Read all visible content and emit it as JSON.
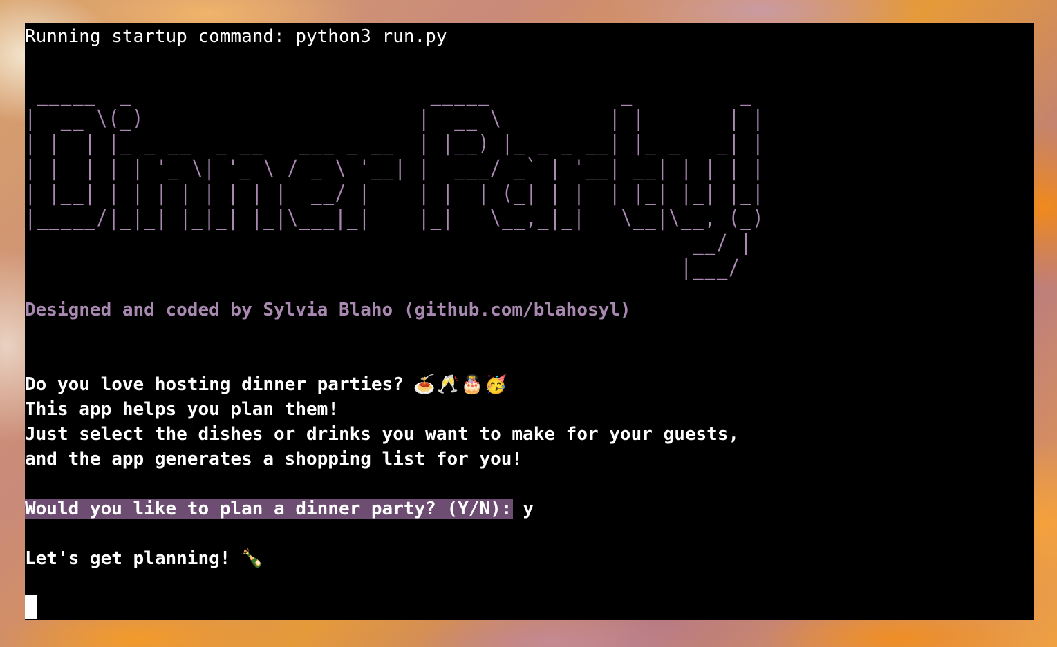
{
  "terminal": {
    "startup_command": "Running startup command: python3 run.py",
    "banner_ascii": " _____  _                         _____           _         _ \n|  __ \\(_)                       |  __ \\         | |       | |\n| |  | |_ _ __  _ __   ___ _ __  | |__) |_ _ _ __| |_ _   _| |\n| |  | | | '_ \\| '_ \\ / _ \\ '__| |  ___/ _` | '__| __| | | | |\n| |__| | | | | | | | |  __/ |    | |  | (_| | |  | |_| |_| |_|\n|_____/|_|_| |_|_| |_|\\___|_|    |_|   \\__,_|_|   \\__|\\__, (_)\n                                                        __/ |  \n                                                       |___/   ",
    "banner_text": "Dinner Party!",
    "credit": "Designed and coded by Sylvia Blaho (github.com/blahosyl)",
    "intro_line_1": "Do you love hosting dinner parties?",
    "intro_emoji": "🍝🥂🎂🥳",
    "intro_line_2": "This app helps you plan them!",
    "intro_line_3": "Just select the dishes or drinks you want to make for your guests,",
    "intro_line_4": "and the app generates a shopping list for you!",
    "prompt": "Would you like to plan a dinner party? (Y/N):",
    "answer": "y",
    "confirmation": "Let's get planning!",
    "confirmation_emoji": "🍾"
  },
  "colors": {
    "terminal_bg": "#000000",
    "text": "#ffffff",
    "accent_purple": "#a988b1",
    "prompt_highlight": "#6d4d72"
  }
}
